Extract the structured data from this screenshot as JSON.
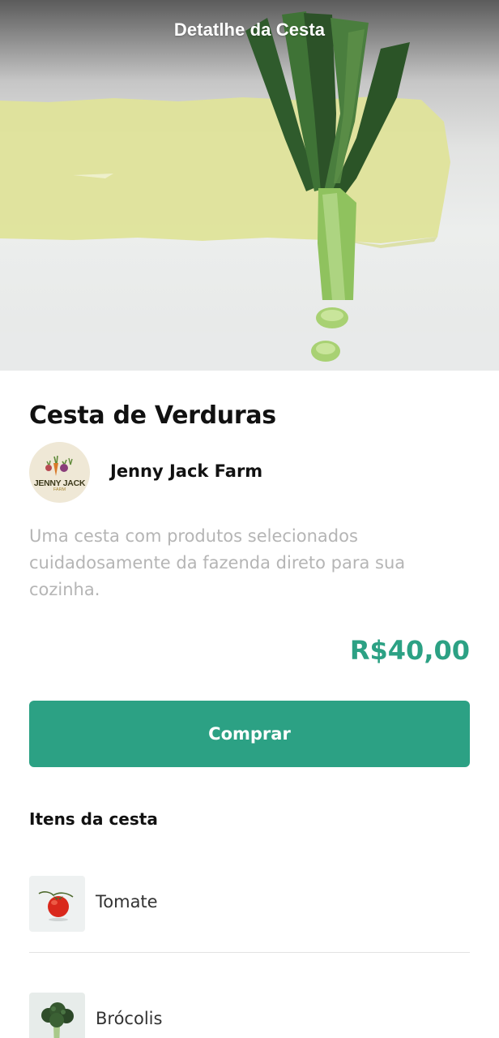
{
  "header": {
    "title": "Detatlhe da Cesta"
  },
  "basket": {
    "name": "Cesta de Verduras",
    "description": "Uma cesta com produtos selecionados cuidadosamente da fazenda direto para sua cozinha.",
    "price": "R$40,00"
  },
  "farm": {
    "name": "Jenny Jack Farm",
    "logo_text": "JENNY JACK",
    "logo_subtext": "FARM"
  },
  "actions": {
    "buy_label": "Comprar"
  },
  "items_section": {
    "heading": "Itens da cesta",
    "items": [
      {
        "name": "Tomate",
        "icon": "tomato-image"
      },
      {
        "name": "Brócolis",
        "icon": "broccoli-image"
      }
    ]
  },
  "colors": {
    "accent": "#2ca184",
    "title_text": "#111111",
    "description_text": "#b5b5b5"
  }
}
